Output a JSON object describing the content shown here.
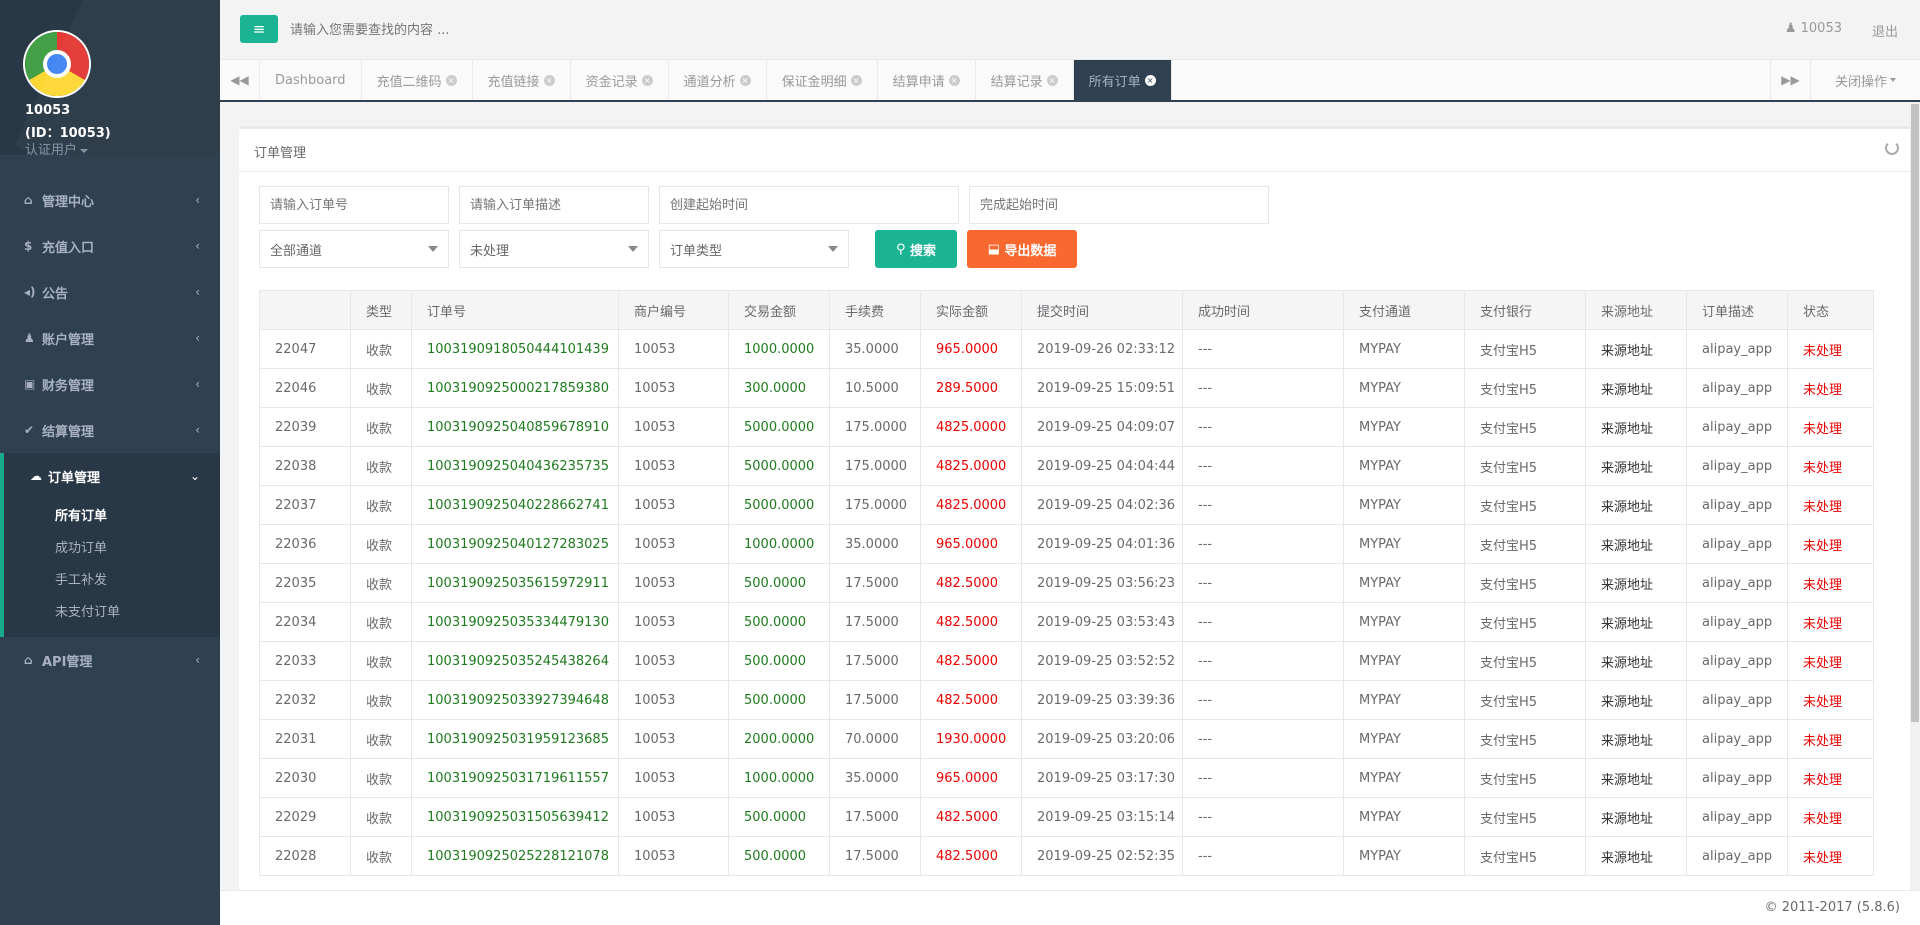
{
  "profile": {
    "name": "10053",
    "id_label": "(ID：10053)",
    "role": "认证用户"
  },
  "nav": {
    "items": [
      {
        "icon": "⌂",
        "label": "管理中心"
      },
      {
        "icon": "$",
        "label": "充值入口"
      },
      {
        "icon": "◂)",
        "label": "公告"
      },
      {
        "icon": "♟",
        "label": "账户管理"
      },
      {
        "icon": "▣",
        "label": "财务管理"
      },
      {
        "icon": "✔",
        "label": "结算管理"
      },
      {
        "icon": "☁",
        "label": "订单管理"
      },
      {
        "icon": "⌂",
        "label": "API管理"
      }
    ],
    "sub_items": [
      "所有订单",
      "成功订单",
      "手工补发",
      "未支付订单"
    ]
  },
  "topbar": {
    "search_placeholder": "请输入您需要查找的内容 ...",
    "user": "10053",
    "logout": "退出"
  },
  "tabs": [
    "Dashboard",
    "充值二维码",
    "充值链接",
    "资金记录",
    "通道分析",
    "保证金明细",
    "结算申请",
    "结算记录",
    "所有订单"
  ],
  "close_ops": "关闭操作",
  "panel": {
    "title": "订单管理"
  },
  "filters": {
    "order_no_placeholder": "请输入订单号",
    "order_desc_placeholder": "请输入订单描述",
    "create_time_placeholder": "创建起始时间",
    "finish_time_placeholder": "完成起始时间",
    "channel": "全部通道",
    "status": "未处理",
    "order_type": "订单类型",
    "search_button": "搜索",
    "export_button": "导出数据"
  },
  "table": {
    "headers": [
      "",
      "类型",
      "订单号",
      "商户编号",
      "交易金额",
      "手续费",
      "实际金额",
      "提交时间",
      "成功时间",
      "支付通道",
      "支付银行",
      "来源地址",
      "订单描述",
      "状态"
    ],
    "rows": [
      [
        "22047",
        "收款",
        "1003190918050444101439",
        "10053",
        "1000.0000",
        "35.0000",
        "965.0000",
        "2019-09-26 02:33:12",
        "---",
        "MYPAY",
        "支付宝H5",
        "来源地址",
        "alipay_app",
        "未处理"
      ],
      [
        "22046",
        "收款",
        "1003190925000217859380",
        "10053",
        "300.0000",
        "10.5000",
        "289.5000",
        "2019-09-25 15:09:51",
        "---",
        "MYPAY",
        "支付宝H5",
        "来源地址",
        "alipay_app",
        "未处理"
      ],
      [
        "22039",
        "收款",
        "1003190925040859678910",
        "10053",
        "5000.0000",
        "175.0000",
        "4825.0000",
        "2019-09-25 04:09:07",
        "---",
        "MYPAY",
        "支付宝H5",
        "来源地址",
        "alipay_app",
        "未处理"
      ],
      [
        "22038",
        "收款",
        "1003190925040436235735",
        "10053",
        "5000.0000",
        "175.0000",
        "4825.0000",
        "2019-09-25 04:04:44",
        "---",
        "MYPAY",
        "支付宝H5",
        "来源地址",
        "alipay_app",
        "未处理"
      ],
      [
        "22037",
        "收款",
        "1003190925040228662741",
        "10053",
        "5000.0000",
        "175.0000",
        "4825.0000",
        "2019-09-25 04:02:36",
        "---",
        "MYPAY",
        "支付宝H5",
        "来源地址",
        "alipay_app",
        "未处理"
      ],
      [
        "22036",
        "收款",
        "1003190925040127283025",
        "10053",
        "1000.0000",
        "35.0000",
        "965.0000",
        "2019-09-25 04:01:36",
        "---",
        "MYPAY",
        "支付宝H5",
        "来源地址",
        "alipay_app",
        "未处理"
      ],
      [
        "22035",
        "收款",
        "1003190925035615972911",
        "10053",
        "500.0000",
        "17.5000",
        "482.5000",
        "2019-09-25 03:56:23",
        "---",
        "MYPAY",
        "支付宝H5",
        "来源地址",
        "alipay_app",
        "未处理"
      ],
      [
        "22034",
        "收款",
        "1003190925035334479130",
        "10053",
        "500.0000",
        "17.5000",
        "482.5000",
        "2019-09-25 03:53:43",
        "---",
        "MYPAY",
        "支付宝H5",
        "来源地址",
        "alipay_app",
        "未处理"
      ],
      [
        "22033",
        "收款",
        "1003190925035245438264",
        "10053",
        "500.0000",
        "17.5000",
        "482.5000",
        "2019-09-25 03:52:52",
        "---",
        "MYPAY",
        "支付宝H5",
        "来源地址",
        "alipay_app",
        "未处理"
      ],
      [
        "22032",
        "收款",
        "1003190925033927394648",
        "10053",
        "500.0000",
        "17.5000",
        "482.5000",
        "2019-09-25 03:39:36",
        "---",
        "MYPAY",
        "支付宝H5",
        "来源地址",
        "alipay_app",
        "未处理"
      ],
      [
        "22031",
        "收款",
        "1003190925031959123685",
        "10053",
        "2000.0000",
        "70.0000",
        "1930.0000",
        "2019-09-25 03:20:06",
        "---",
        "MYPAY",
        "支付宝H5",
        "来源地址",
        "alipay_app",
        "未处理"
      ],
      [
        "22030",
        "收款",
        "1003190925031719611557",
        "10053",
        "1000.0000",
        "35.0000",
        "965.0000",
        "2019-09-25 03:17:30",
        "---",
        "MYPAY",
        "支付宝H5",
        "来源地址",
        "alipay_app",
        "未处理"
      ],
      [
        "22029",
        "收款",
        "1003190925031505639412",
        "10053",
        "500.0000",
        "17.5000",
        "482.5000",
        "2019-09-25 03:15:14",
        "---",
        "MYPAY",
        "支付宝H5",
        "来源地址",
        "alipay_app",
        "未处理"
      ],
      [
        "22028",
        "收款",
        "1003190925025228121078",
        "10053",
        "500.0000",
        "17.5000",
        "482.5000",
        "2019-09-25 02:52:35",
        "---",
        "MYPAY",
        "支付宝H5",
        "来源地址",
        "alipay_app",
        "未处理"
      ]
    ]
  },
  "footer": {
    "copyright": "© 2011-2017 (5.8.6)"
  },
  "colors": {
    "sidebar": "#2f4050",
    "accent": "#1ab394",
    "export": "#f8682f",
    "amount_green": "#1e7b1e",
    "amount_red": "#e00000"
  }
}
